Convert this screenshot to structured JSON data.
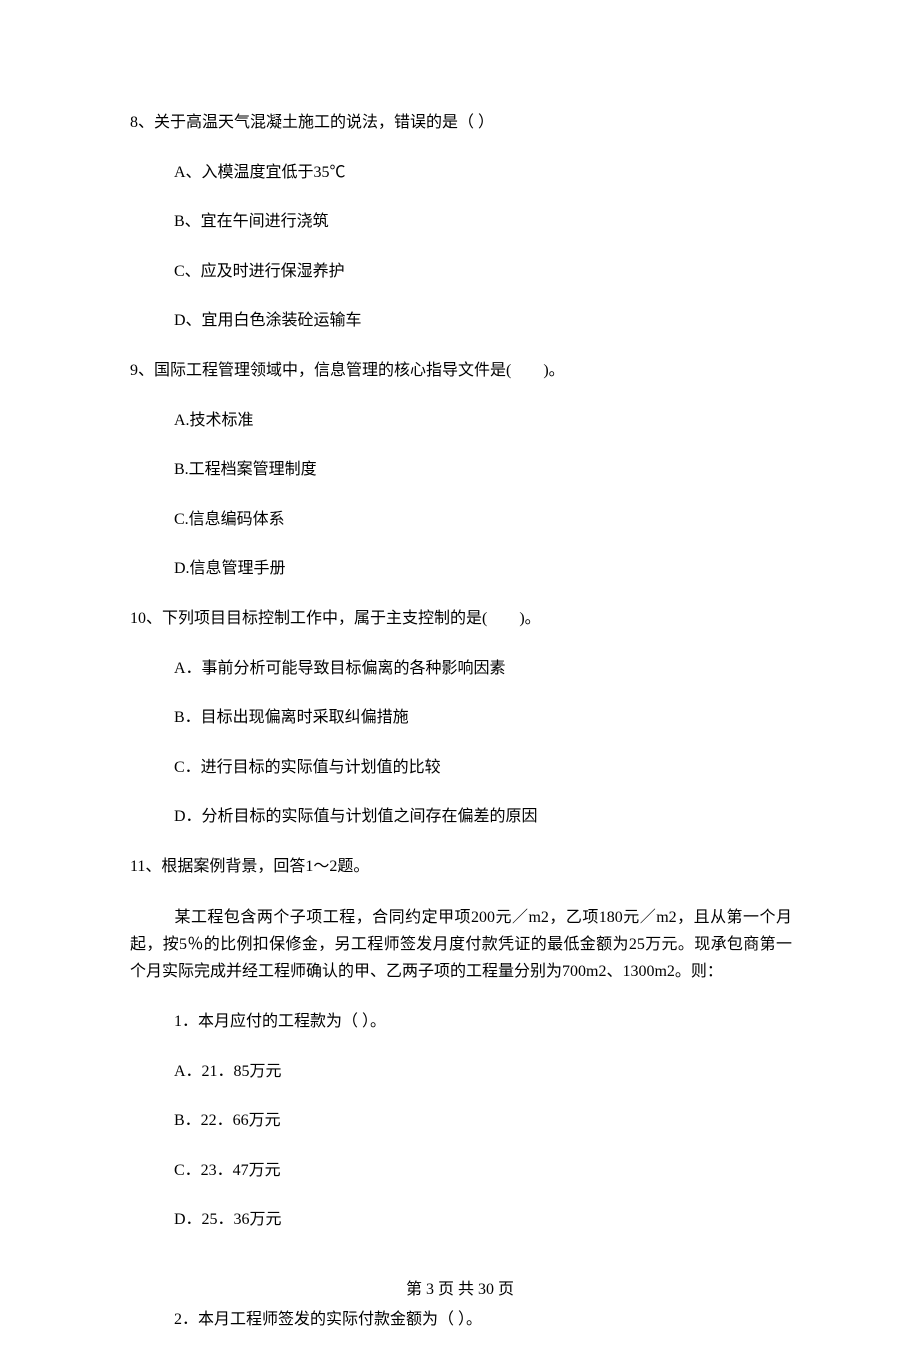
{
  "questions": {
    "q8": {
      "stem": "8、关于高温天气混凝土施工的说法，错误的是（  ）",
      "A": "A、入模温度宜低于35℃",
      "B": "B、宜在午间进行浇筑",
      "C": "C、应及时进行保湿养护",
      "D": "D、宜用白色涂装砼运输车"
    },
    "q9": {
      "stem": "9、国际工程管理领域中，信息管理的核心指导文件是(　　)。",
      "A": "A.技术标准",
      "B": "B.工程档案管理制度",
      "C": "C.信息编码体系",
      "D": "D.信息管理手册"
    },
    "q10": {
      "stem": "10、下列项目目标控制工作中，属于主支控制的是(　　)。",
      "A": "A．事前分析可能导致目标偏离的各种影响因素",
      "B": "B．目标出现偏离时采取纠偏措施",
      "C": "C．进行目标的实际值与计划值的比较",
      "D": "D．分析目标的实际值与计划值之间存在偏差的原因"
    },
    "q11": {
      "stem": "11、根据案例背景，回答1～2题。",
      "para": "某工程包含两个子项工程，合同约定甲项200元／m2，乙项180元／m2，且从第一个月起，按5％的比例扣保修金，另工程师签发月度付款凭证的最低金额为25万元。现承包商第一个月实际完成并经工程师确认的甲、乙两子项的工程量分别为700m2、1300m2。则：",
      "sub1": "1．本月应付的工程款为（  ）。",
      "A1": "A．21．85万元",
      "B1": "B．22．66万元",
      "C1": "C．23．47万元",
      "D1": "D．25．36万元",
      "sub2": "2．本月工程师签发的实际付款金额为（  ）。"
    }
  },
  "footer": "第 3 页 共 30 页"
}
